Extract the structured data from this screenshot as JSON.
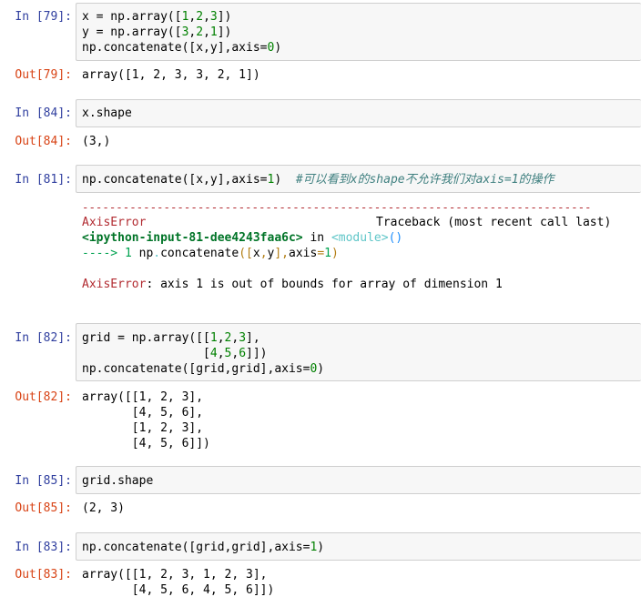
{
  "cells": [
    {
      "in_prompt": "In [79]:",
      "code_lines": [
        [
          "x = np.array([",
          "1",
          ",",
          "2",
          ",",
          "3",
          "])"
        ],
        [
          "y = np.array([",
          "3",
          ",",
          "2",
          ",",
          "1",
          "])"
        ],
        [
          "np.concatenate([x,y],axis=",
          "0",
          ")"
        ]
      ],
      "out_prompt": "Out[79]:",
      "output": "array([1, 2, 3, 3, 2, 1])"
    },
    {
      "in_prompt": "In [84]:",
      "code": "x.shape",
      "out_prompt": "Out[84]:",
      "output": "(3,)"
    },
    {
      "in_prompt": "In [81]:",
      "code_prefix": "np.concatenate([x,y],axis=",
      "code_num": "1",
      "code_suffix": ")",
      "comment": "#可以看到x的shape不允许我们对axis=1的操作",
      "traceback": {
        "rule": "---------------------------------------------------------------------------",
        "error_name": "AxisError",
        "header_right": "Traceback (most recent call last)",
        "input_ref": "<ipython-input-81-dee4243faa6c>",
        "in_word": " in ",
        "module": "<module>",
        "call_parens": "()",
        "arrow": "----> 1",
        "line_pre": " np",
        "line_dot": ".",
        "line_fn": "concatenate",
        "line_open": "(",
        "line_br1": "[",
        "line_x": "x",
        "line_comma1": ",",
        "line_y": "y",
        "line_br2": "]",
        "line_comma2": ",",
        "line_axis": "axis",
        "line_eq": "=",
        "line_one": "1",
        "line_close": ")",
        "final_name": "AxisError",
        "final_msg": ": axis 1 is out of bounds for array of dimension 1"
      }
    },
    {
      "in_prompt": "In [82]:",
      "code_lines": [
        [
          "grid = np.array([[",
          "1",
          ",",
          "2",
          ",",
          "3",
          "],"
        ],
        [
          "                 [",
          "4",
          ",",
          "5",
          ",",
          "6",
          "]])"
        ],
        [
          "np.concatenate([grid,grid],axis=",
          "0",
          ")"
        ]
      ],
      "out_prompt": "Out[82]:",
      "output": "array([[1, 2, 3],\n       [4, 5, 6],\n       [1, 2, 3],\n       [4, 5, 6]])"
    },
    {
      "in_prompt": "In [85]:",
      "code": "grid.shape",
      "out_prompt": "Out[85]:",
      "output": "(2, 3)"
    },
    {
      "in_prompt": "In [83]:",
      "code_prefix": "np.concatenate([grid,grid],axis=",
      "code_num": "1",
      "code_suffix": ")",
      "out_prompt": "Out[83]:",
      "output": "array([[1, 2, 3, 1, 2, 3],\n       [4, 5, 6, 4, 5, 6]])"
    }
  ]
}
